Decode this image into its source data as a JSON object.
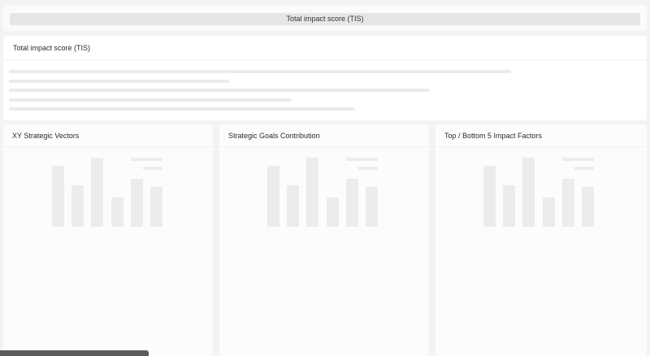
{
  "header": {
    "title": "Total impact score (TIS)"
  },
  "tis_card": {
    "title": "Total impact score (TIS)"
  },
  "chart_cards": [
    {
      "title": "XY Strategic Vectors"
    },
    {
      "title": "Strategic Goals Contribution"
    },
    {
      "title": "Top / Bottom 5 Impact Factors"
    }
  ]
}
